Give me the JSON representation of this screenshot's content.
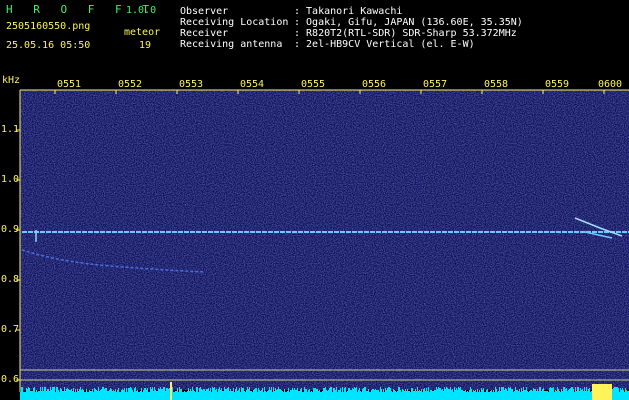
{
  "header": {
    "app_title": "H R O F F T",
    "version": "1.0.0",
    "filename": "2505160550.png",
    "meteor_label": "meteor",
    "datetime": "25.05.16 05:50",
    "meteor_count": "19",
    "info": [
      {
        "label": "Observer",
        "value": ": Takanori Kawachi"
      },
      {
        "label": "Receiving Location",
        "value": ": Ogaki, Gifu, JAPAN (136.60E, 35.35N)"
      },
      {
        "label": "Receiver",
        "value": ": R820T2(RTL-SDR) SDR-Sharp 53.372MHz"
      },
      {
        "label": "Receiving antenna",
        "value": ": 2el-HB9CV Vertical (el. E-W)"
      }
    ]
  },
  "axis": {
    "unit": "kHz",
    "time_ticks": [
      "0551",
      "0552",
      "0553",
      "0554",
      "0555",
      "0556",
      "0557",
      "0558",
      "0559",
      "0600"
    ],
    "freq_ticks": [
      "1.1",
      "1.0",
      "0.9",
      "0.8",
      "0.7",
      "0.6"
    ]
  },
  "colors": {
    "text_green": "#3cf06a",
    "text_yellow": "#fff35a",
    "background_noise": "#141a6e",
    "carrier_line": "#6ec8ff",
    "level_bar": "#00e5ff"
  }
}
